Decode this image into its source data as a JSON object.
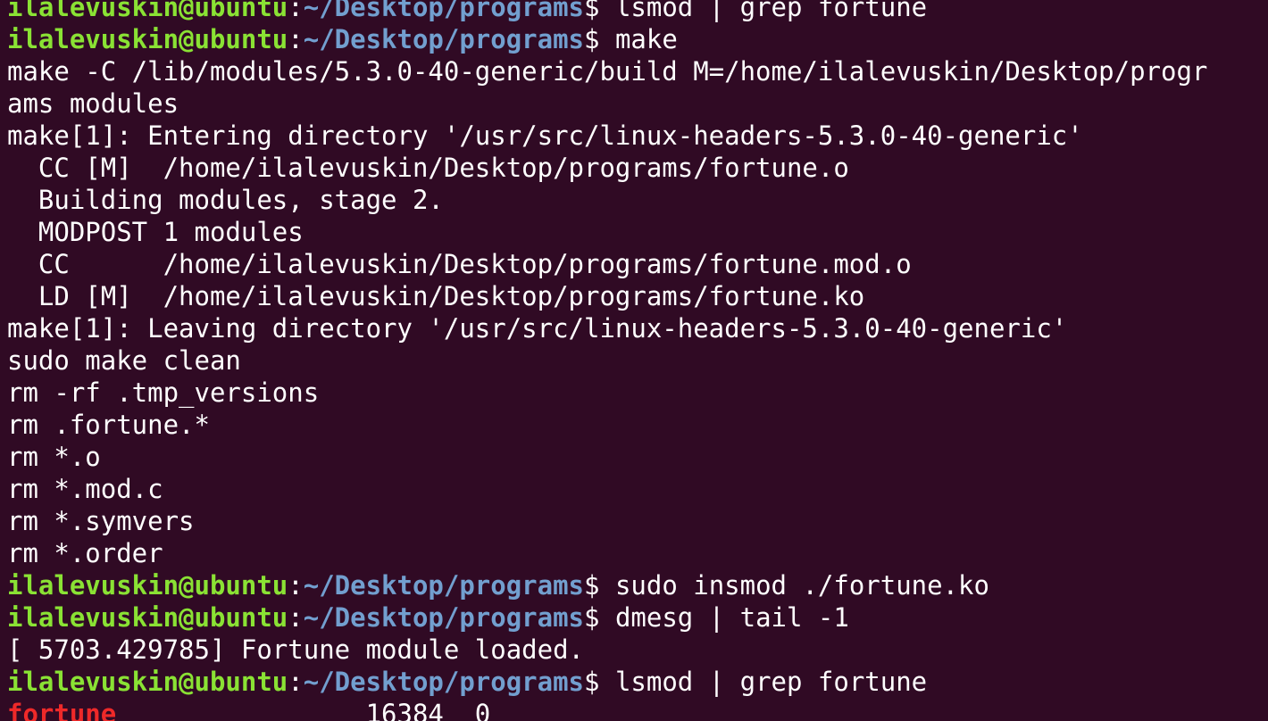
{
  "terminal": {
    "prompt_user": "ilalevuskin@ubuntu",
    "prompt_sep": ":",
    "prompt_path": "~/Desktop/programs",
    "prompt_suffix": "$ ",
    "top_partial": {
      "user": "ilalevuskin@ubuntu",
      "path": "~/Desktop/programs",
      "rest": "$ lsmod | grep fortune"
    },
    "lines": [
      {
        "kind": "prompt",
        "cmd": "make"
      },
      {
        "kind": "out",
        "text": "make -C /lib/modules/5.3.0-40-generic/build M=/home/ilalevuskin/Desktop/progr"
      },
      {
        "kind": "out",
        "text": "ams modules"
      },
      {
        "kind": "out",
        "text": "make[1]: Entering directory '/usr/src/linux-headers-5.3.0-40-generic'"
      },
      {
        "kind": "out",
        "text": "  CC [M]  /home/ilalevuskin/Desktop/programs/fortune.o"
      },
      {
        "kind": "out",
        "text": "  Building modules, stage 2."
      },
      {
        "kind": "out",
        "text": "  MODPOST 1 modules"
      },
      {
        "kind": "out",
        "text": "  CC      /home/ilalevuskin/Desktop/programs/fortune.mod.o"
      },
      {
        "kind": "out",
        "text": "  LD [M]  /home/ilalevuskin/Desktop/programs/fortune.ko"
      },
      {
        "kind": "out",
        "text": "make[1]: Leaving directory '/usr/src/linux-headers-5.3.0-40-generic'"
      },
      {
        "kind": "out",
        "text": "sudo make clean"
      },
      {
        "kind": "out",
        "text": "rm -rf .tmp_versions"
      },
      {
        "kind": "out",
        "text": "rm .fortune.*"
      },
      {
        "kind": "out",
        "text": "rm *.o"
      },
      {
        "kind": "out",
        "text": "rm *.mod.c"
      },
      {
        "kind": "out",
        "text": "rm *.symvers"
      },
      {
        "kind": "out",
        "text": "rm *.order"
      },
      {
        "kind": "prompt",
        "cmd": "sudo insmod ./fortune.ko"
      },
      {
        "kind": "prompt",
        "cmd": "dmesg | tail -1"
      },
      {
        "kind": "out",
        "text": "[ 5703.429785] Fortune module loaded."
      },
      {
        "kind": "prompt",
        "cmd": "lsmod | grep fortune"
      },
      {
        "kind": "grep",
        "match": "fortune",
        "rest": "                16384  0"
      }
    ]
  },
  "colors": {
    "background": "#300a24",
    "user": "#8ae234",
    "path": "#729fcf",
    "text": "#ffffff",
    "grep_match": "#ef2929"
  }
}
